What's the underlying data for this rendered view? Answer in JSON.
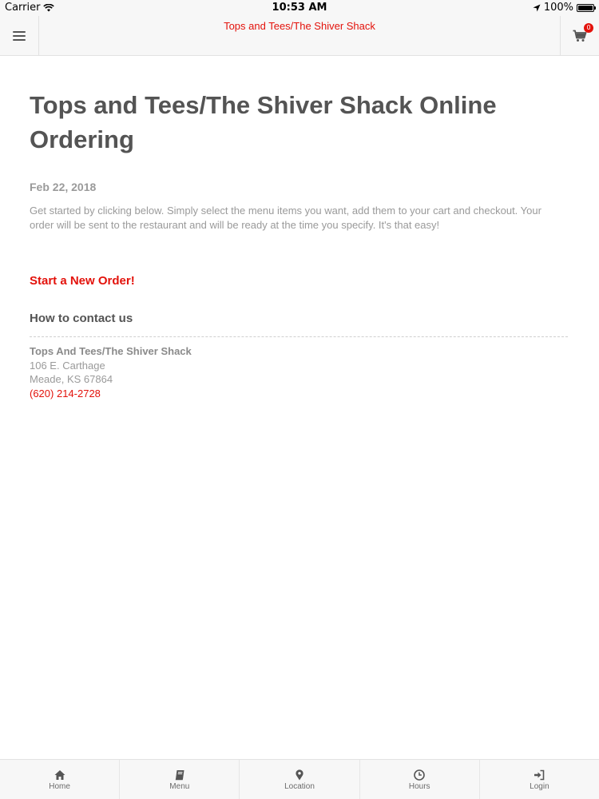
{
  "status_bar": {
    "carrier": "Carrier",
    "time": "10:53 AM",
    "battery": "100%",
    "battery_level": 1.0
  },
  "nav": {
    "title": "Tops and Tees/The Shiver Shack",
    "cart_count": "0",
    "menu_icon": "hamburger-icon",
    "cart_icon": "cart-icon"
  },
  "main": {
    "title": "Tops and Tees/The Shiver Shack Online Ordering",
    "date": "Feb 22, 2018",
    "intro": "Get started by clicking below. Simply select the menu items you want, add them to your cart and checkout. Your order will be sent to the restaurant and will be ready at the time you specify. It's that easy!",
    "start_order": "Start a New Order!",
    "contact_heading": "How to contact us",
    "contact": {
      "name": "Tops And Tees/The Shiver Shack",
      "street": "106 E. Carthage",
      "city": "Meade, KS 67864",
      "phone": "(620) 214-2728"
    }
  },
  "tabs": [
    {
      "label": "Home",
      "icon": "home-icon"
    },
    {
      "label": "Menu",
      "icon": "book-icon"
    },
    {
      "label": "Location",
      "icon": "map-pin-icon"
    },
    {
      "label": "Hours",
      "icon": "clock-icon"
    },
    {
      "label": "Login",
      "icon": "sign-in-icon"
    }
  ],
  "colors": {
    "accent": "#e3120b",
    "heading": "#545454",
    "muted": "#9a9a9a",
    "bar_bg": "#f7f7f7"
  }
}
